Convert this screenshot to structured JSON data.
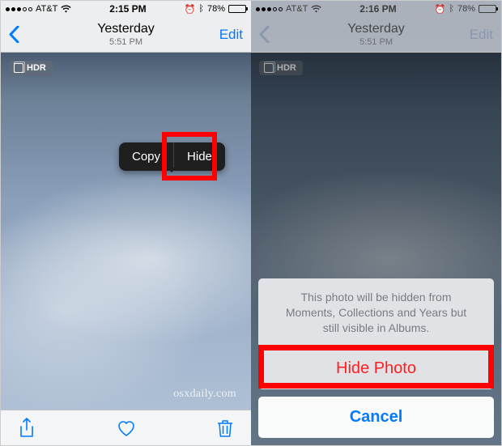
{
  "left": {
    "status": {
      "carrier": "AT&T",
      "time": "2:15 PM",
      "battery_pct": "78%"
    },
    "nav": {
      "title": "Yesterday",
      "subtitle": "5:51 PM",
      "edit": "Edit"
    },
    "hdr": "HDR",
    "popup": {
      "copy": "Copy",
      "hide": "Hide"
    },
    "watermark": "osxdaily.com"
  },
  "right": {
    "status": {
      "carrier": "AT&T",
      "time": "2:16 PM",
      "battery_pct": "78%"
    },
    "nav": {
      "title": "Yesterday",
      "subtitle": "5:51 PM",
      "edit": "Edit"
    },
    "hdr": "HDR",
    "sheet": {
      "message": "This photo will be hidden from Moments, Collections and Years but still visible in Albums.",
      "hide": "Hide Photo",
      "cancel": "Cancel"
    }
  }
}
